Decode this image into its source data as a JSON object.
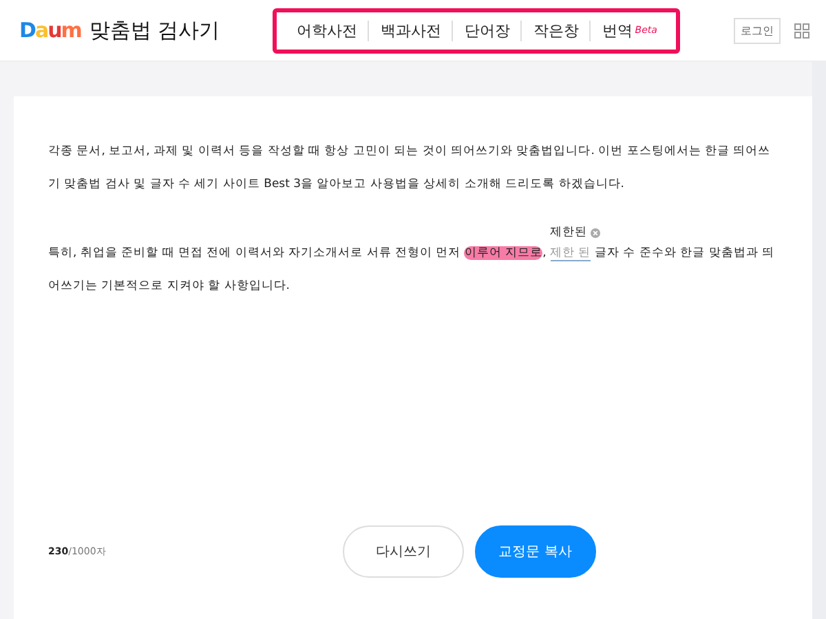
{
  "header": {
    "logo": "Daum",
    "title": "맞춤법 검사기",
    "nav": [
      {
        "label": "어학사전"
      },
      {
        "label": "백과사전"
      },
      {
        "label": "단어장"
      },
      {
        "label": "작은창"
      },
      {
        "label": "번역",
        "badge": "Beta"
      }
    ],
    "login": "로그인"
  },
  "editor": {
    "paragraphs": [
      [
        {
          "kind": "plain",
          "text": "각종 문서, 보고서, 과제 및 이력서 등을 작성할 때 항상 고민이 되는 것이 띄어쓰기와 맞춤법입니다. 이번 포스팅에서는 한글 띄어쓰기 맞춤법 검사 및 글자 수 세기 사이트 Best 3을 알아보고 사용법을 상세히 소개해 드리도록 하겠습니다."
        }
      ],
      [
        {
          "kind": "plain",
          "text": "특히, 취업을 준비할 때 면접 전에 이력서와 자기소개서로 서류 전형이 먼저 "
        },
        {
          "kind": "error",
          "text": "이루어 지므로"
        },
        {
          "kind": "plain",
          "text": ", "
        },
        {
          "kind": "correction",
          "text": "제한 된",
          "suggestion": "제한된"
        },
        {
          "kind": "plain",
          "text": " 글자 수 준수와 한글 맞춤법과 띄어쓰기는 기본적으로 지켜야 할 사항입니다."
        }
      ]
    ],
    "count": "**230**/1000자",
    "buttons": [
      {
        "label": "다시쓰기",
        "kind": "secondary"
      },
      {
        "label": "교정문 복사",
        "kind": "primary"
      }
    ]
  }
}
